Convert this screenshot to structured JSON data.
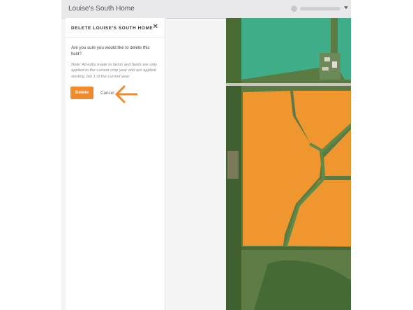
{
  "app": {
    "title": "Louise's South Home"
  },
  "dialog": {
    "title": "DELETE LOUISE'S SOUTH HOME",
    "close_icon": "close-icon",
    "question": "Are you sure you would like to delete this field?",
    "note": "Note: All edits made to farms and fields are only applied to the current crop year and are applied starting Jan 1 of the current year",
    "delete_label": "Delete",
    "cancel_label": "Cancel"
  },
  "map_controls": {
    "zoom_in": "+",
    "zoom_out": "−",
    "icons": [
      "zoom-in-icon",
      "zoom-out-icon",
      "fullscreen-icon",
      "locate-icon",
      "layers-icon"
    ]
  },
  "colors": {
    "accent": "#f08a2c",
    "field_selected": "#f0962f",
    "field_other": "#3fae88",
    "annotation_arrow": "#f08a2c"
  }
}
